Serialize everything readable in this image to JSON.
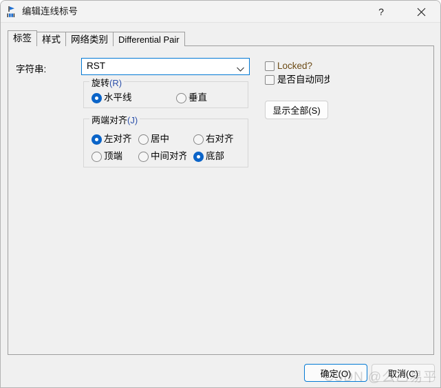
{
  "window": {
    "title": "编辑连线标号",
    "icon": "net-label-icon",
    "help_label": "?",
    "close_label": "×"
  },
  "tabs": [
    {
      "label": "标签",
      "active": true
    },
    {
      "label": "样式",
      "active": false
    },
    {
      "label": "网络类别",
      "active": false
    },
    {
      "label": "Differential Pair",
      "active": false
    }
  ],
  "form": {
    "string_label": "字符串:",
    "string_value": "RST",
    "string_placeholder": "RST"
  },
  "rotation_group": {
    "title_text": "旋转",
    "title_mnemonic": "(R)",
    "options": [
      {
        "label": "水平线",
        "selected": true
      },
      {
        "label": "垂直",
        "selected": false
      }
    ]
  },
  "justify_group": {
    "title_text": "两端对齐",
    "title_mnemonic": "(J)",
    "options": [
      {
        "label": "左对齐",
        "selected": true
      },
      {
        "label": "居中",
        "selected": false
      },
      {
        "label": "右对齐",
        "selected": false
      },
      {
        "label": "顶端",
        "selected": false
      },
      {
        "label": "中间对齐",
        "selected": false
      },
      {
        "label": "底部",
        "selected": true
      }
    ]
  },
  "checkboxes": [
    {
      "label": "Locked?",
      "checked": false
    },
    {
      "label": "是否自动同步",
      "checked": false
    }
  ],
  "side_buttons": {
    "show_all": "显示全部(S)"
  },
  "footer": {
    "ok": "确定(O)",
    "cancel": "取消(C)"
  },
  "watermark": {
    "brand": "CSDN",
    "user": "@么乙易平"
  },
  "colors": {
    "accent": "#0078d4",
    "radio_selected": "#0b64c8",
    "dialog_bg": "#f0f0f0",
    "titlebar_bg": "#f3f3f3",
    "group_border": "#d6d6d6",
    "tab_border": "#9d9d9d"
  }
}
